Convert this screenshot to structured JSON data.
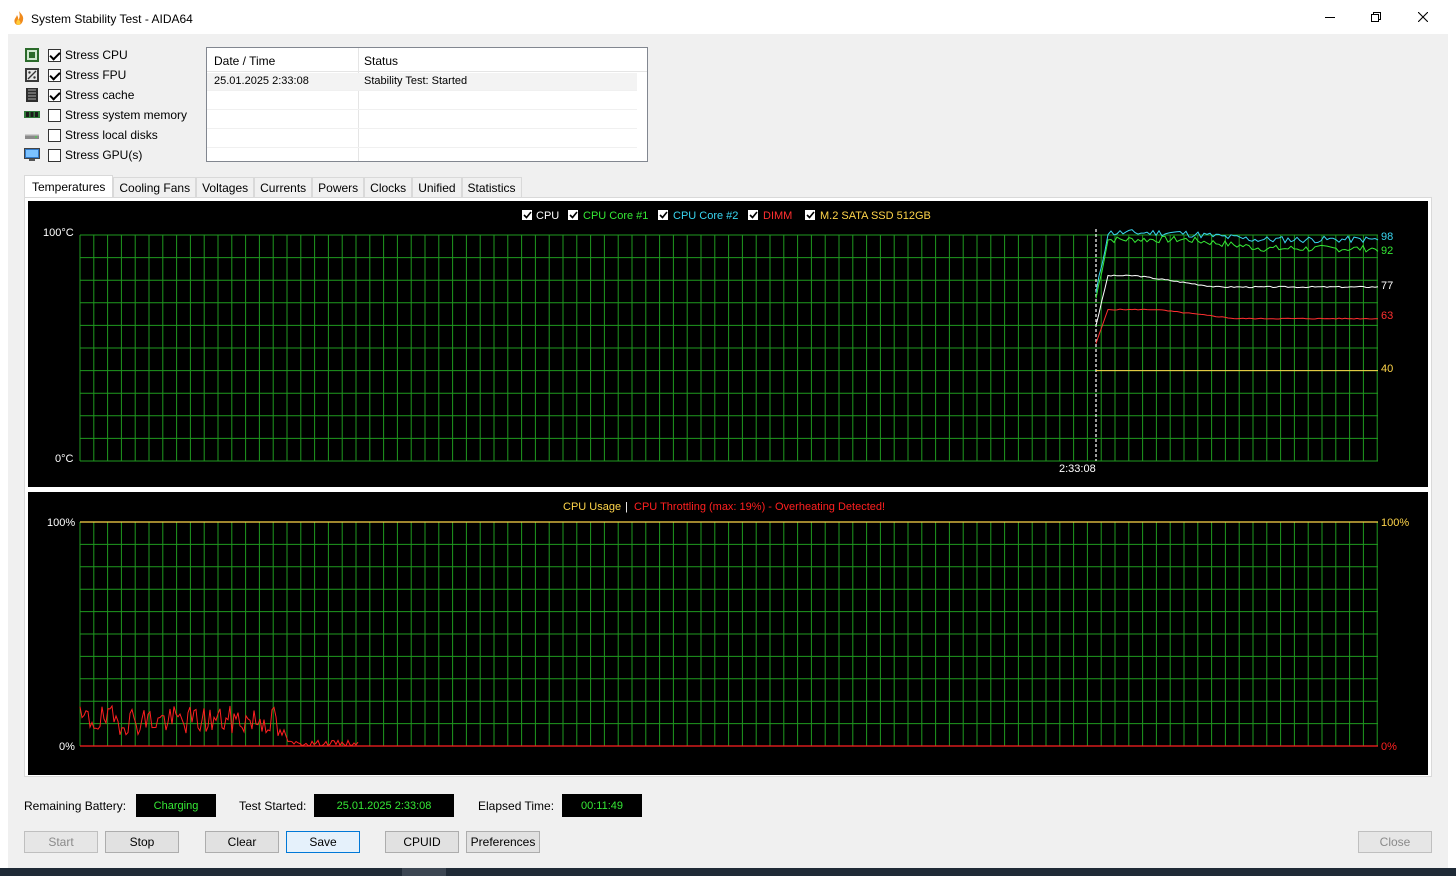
{
  "window": {
    "title": "System Stability Test - AIDA64",
    "minimize_icon": "minimize-icon",
    "maximize_icon": "restore-icon",
    "close_icon": "close-icon"
  },
  "stress_options": [
    {
      "label": "Stress CPU",
      "checked": true,
      "icon": "cpu-chip-icon"
    },
    {
      "label": "Stress FPU",
      "checked": true,
      "icon": "fpu-chip-icon"
    },
    {
      "label": "Stress cache",
      "checked": true,
      "icon": "cache-chip-icon"
    },
    {
      "label": "Stress system memory",
      "checked": false,
      "icon": "memory-module-icon"
    },
    {
      "label": "Stress local disks",
      "checked": false,
      "icon": "disk-drive-icon"
    },
    {
      "label": "Stress GPU(s)",
      "checked": false,
      "icon": "monitor-icon"
    }
  ],
  "log": {
    "headers": [
      "Date / Time",
      "Status"
    ],
    "rows": [
      {
        "datetime": "25.01.2025 2:33:08",
        "status": "Stability Test: Started"
      }
    ]
  },
  "tabs": [
    "Temperatures",
    "Cooling Fans",
    "Voltages",
    "Currents",
    "Powers",
    "Clocks",
    "Unified",
    "Statistics"
  ],
  "active_tab": "Temperatures",
  "temperature_chart": {
    "legend": [
      {
        "name": "CPU",
        "color": "#ffffff",
        "checked": true
      },
      {
        "name": "CPU Core #1",
        "color": "#35e835",
        "checked": true
      },
      {
        "name": "CPU Core #2",
        "color": "#39d6f0",
        "checked": true
      },
      {
        "name": "DIMM",
        "color": "#ff3030",
        "checked": true
      },
      {
        "name": "M.2 SATA SSD 512GB",
        "color": "#ffd54a",
        "checked": true
      }
    ],
    "y_top_label": "100°C",
    "y_bottom_label": "0°C",
    "x_marker_label": "2:33:08",
    "end_values": [
      {
        "value": "98",
        "color": "#39d6f0"
      },
      {
        "value": "92",
        "color": "#35e835"
      },
      {
        "value": "77",
        "color": "#ffffff"
      },
      {
        "value": "63",
        "color": "#ff3030"
      },
      {
        "value": "40",
        "color": "#ffd54a"
      }
    ]
  },
  "usage_chart": {
    "title_usage": "CPU Usage",
    "separator": "|",
    "title_throttle": "CPU Throttling (max: 19%) - Overheating Detected!",
    "usage_color": "#ffd54a",
    "throttle_color": "#ff2020",
    "y_top_left": "100%",
    "y_bottom_left": "0%",
    "y_top_right": "100%",
    "y_bottom_right": "0%"
  },
  "chart_data": [
    {
      "type": "line",
      "ylim": [
        0,
        100
      ],
      "series": [
        {
          "name": "CPU Core #2",
          "last": 98
        },
        {
          "name": "CPU Core #1",
          "last": 92
        },
        {
          "name": "CPU",
          "last": 77
        },
        {
          "name": "DIMM",
          "last": 63
        },
        {
          "name": "M.2 SATA SSD 512GB",
          "last": 40
        }
      ]
    },
    {
      "type": "line",
      "ylim": [
        0,
        100
      ],
      "series": [
        {
          "name": "CPU Usage",
          "last": 100
        },
        {
          "name": "CPU Throttling",
          "max": 19,
          "last": 0
        }
      ]
    }
  ],
  "status": {
    "battery_label": "Remaining Battery:",
    "battery_value": "Charging",
    "started_label": "Test Started:",
    "started_value": "25.01.2025 2:33:08",
    "elapsed_label": "Elapsed Time:",
    "elapsed_value": "00:11:49"
  },
  "buttons": {
    "start": "Start",
    "stop": "Stop",
    "clear": "Clear",
    "save": "Save",
    "cpuid": "CPUID",
    "preferences": "Preferences",
    "close": "Close"
  }
}
